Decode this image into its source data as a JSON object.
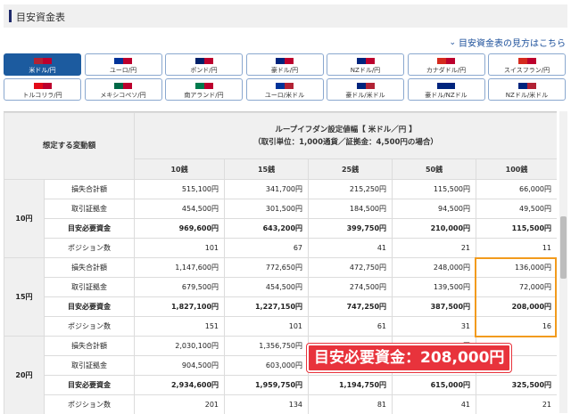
{
  "header": {
    "title": "目安資金表",
    "help_link": "目安資金表の見方はこちら"
  },
  "pairs": [
    {
      "label": "米ドル/円",
      "active": true,
      "flags": [
        "#b22234",
        "#bc002d"
      ]
    },
    {
      "label": "ユーロ/円",
      "active": false,
      "flags": [
        "#003399",
        "#bc002d"
      ]
    },
    {
      "label": "ポンド/円",
      "active": false,
      "flags": [
        "#012169",
        "#bc002d"
      ]
    },
    {
      "label": "豪ドル/円",
      "active": false,
      "flags": [
        "#00247d",
        "#bc002d"
      ]
    },
    {
      "label": "NZドル/円",
      "active": false,
      "flags": [
        "#00247d",
        "#bc002d"
      ]
    },
    {
      "label": "カナダドル/円",
      "active": false,
      "flags": [
        "#d52b1e",
        "#bc002d"
      ]
    },
    {
      "label": "スイスフラン/円",
      "active": false,
      "flags": [
        "#d52b1e",
        "#bc002d"
      ]
    },
    {
      "label": "トルコリラ/円",
      "active": false,
      "flags": [
        "#e30a17",
        "#bc002d"
      ]
    },
    {
      "label": "メキシコペソ/円",
      "active": false,
      "flags": [
        "#006847",
        "#bc002d"
      ]
    },
    {
      "label": "南アランド/円",
      "active": false,
      "flags": [
        "#007a4d",
        "#bc002d"
      ]
    },
    {
      "label": "ユーロ/米ドル",
      "active": false,
      "flags": [
        "#003399",
        "#b22234"
      ]
    },
    {
      "label": "豪ドル/米ドル",
      "active": false,
      "flags": [
        "#00247d",
        "#b22234"
      ]
    },
    {
      "label": "豪ドル/NZドル",
      "active": false,
      "flags": [
        "#00247d",
        "#00247d"
      ]
    },
    {
      "label": "NZドル/米ドル",
      "active": false,
      "flags": [
        "#00247d",
        "#b22234"
      ]
    }
  ],
  "table": {
    "corner": "想定する変動額",
    "title_line1": "ループイフダン設定値幅【 米ドル／円 】",
    "title_line2": "（取引単位：1,000通貨／証拠金：4,500円の場合）",
    "columns": [
      "10銭",
      "15銭",
      "25銭",
      "50銭",
      "100銭"
    ],
    "groups": [
      {
        "label": "10円",
        "rows": [
          {
            "name": "損失合計額",
            "bold": false,
            "values": [
              "515,100円",
              "341,700円",
              "215,250円",
              "115,500円",
              "66,000円"
            ]
          },
          {
            "name": "取引証拠金",
            "bold": false,
            "values": [
              "454,500円",
              "301,500円",
              "184,500円",
              "94,500円",
              "49,500円"
            ]
          },
          {
            "name": "目安必要資金",
            "bold": true,
            "values": [
              "969,600円",
              "643,200円",
              "399,750円",
              "210,000円",
              "115,500円"
            ]
          },
          {
            "name": "ポジション数",
            "bold": false,
            "values": [
              "101",
              "67",
              "41",
              "21",
              "11"
            ]
          }
        ]
      },
      {
        "label": "15円",
        "rows": [
          {
            "name": "損失合計額",
            "bold": false,
            "values": [
              "1,147,600円",
              "772,650円",
              "472,750円",
              "248,000円",
              "136,000円"
            ]
          },
          {
            "name": "取引証拠金",
            "bold": false,
            "values": [
              "679,500円",
              "454,500円",
              "274,500円",
              "139,500円",
              "72,000円"
            ]
          },
          {
            "name": "目安必要資金",
            "bold": true,
            "values": [
              "1,827,100円",
              "1,227,150円",
              "747,250円",
              "387,500円",
              "208,000円"
            ]
          },
          {
            "name": "ポジション数",
            "bold": false,
            "values": [
              "151",
              "101",
              "61",
              "31",
              "16"
            ]
          }
        ]
      },
      {
        "label": "20円",
        "rows": [
          {
            "name": "損失合計額",
            "bold": false,
            "values": [
              "2,030,100円",
              "1,356,750円",
              "",
              "430,000円",
              ""
            ]
          },
          {
            "name": "取引証拠金",
            "bold": false,
            "values": [
              "904,500円",
              "603,000円",
              "",
              "",
              ""
            ]
          },
          {
            "name": "目安必要資金",
            "bold": true,
            "values": [
              "2,934,600円",
              "1,959,750円",
              "1,194,750円",
              "615,000円",
              "325,500円"
            ]
          },
          {
            "name": "ポジション数",
            "bold": false,
            "values": [
              "201",
              "134",
              "81",
              "41",
              "21"
            ]
          }
        ]
      }
    ]
  },
  "callout": {
    "text": "目安必要資金：208,000円"
  }
}
